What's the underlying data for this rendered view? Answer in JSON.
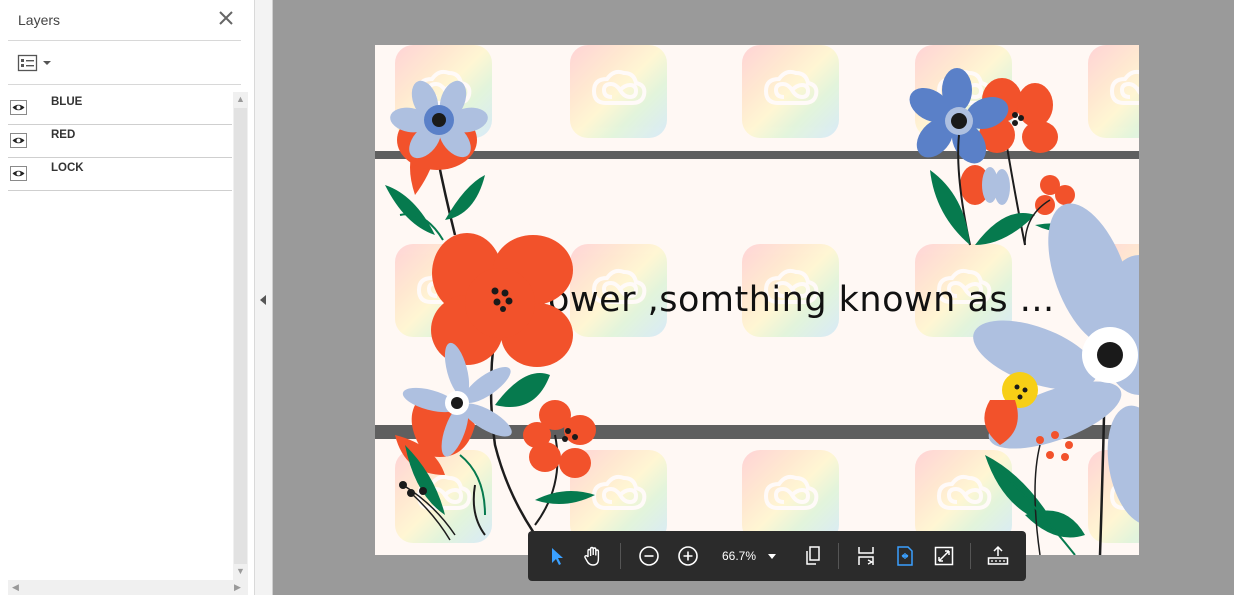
{
  "layers_panel": {
    "title": "Layers",
    "layers": [
      {
        "name": "BLUE",
        "visible": true
      },
      {
        "name": "RED",
        "visible": true
      },
      {
        "name": "LOCK",
        "visible": true
      }
    ]
  },
  "document": {
    "page_text": "flower ,somthing known as ..."
  },
  "toolbar": {
    "zoom": "66.7%",
    "active_color": "#3aa0ff",
    "icons": [
      "select-arrow-icon",
      "hand-icon",
      "zoom-out-icon",
      "zoom-in-icon",
      "page-view-icon",
      "fit-width-icon",
      "fit-page-icon",
      "fullscreen-icon",
      "read-mode-icon"
    ]
  },
  "colors": {
    "orange": "#f2522b",
    "blue": "#5a80c8",
    "pale_blue": "#aec0e0",
    "green": "#067a4e",
    "yellow": "#f7cf16"
  }
}
